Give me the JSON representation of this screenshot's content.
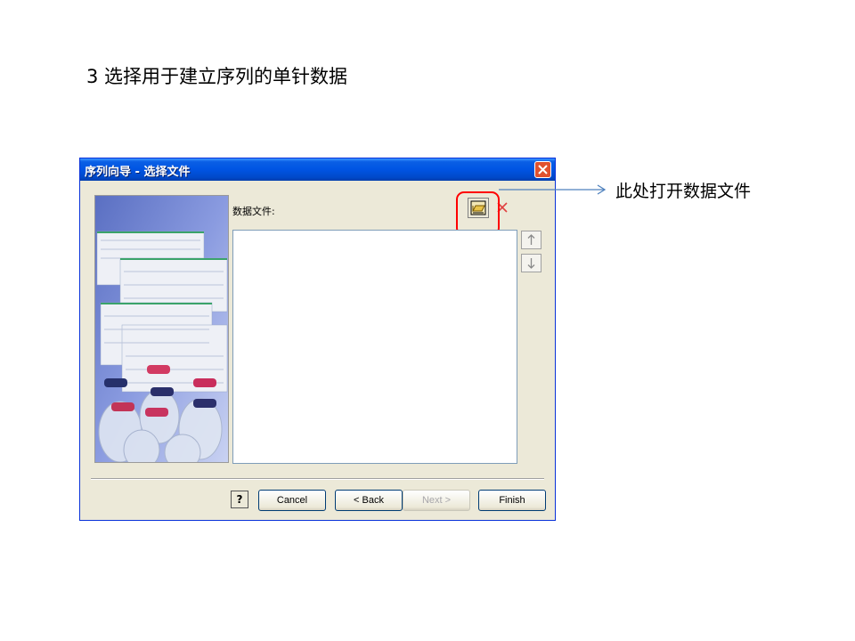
{
  "slide": {
    "title": "3 选择用于建立序列的单针数据",
    "callout": "此处打开数据文件"
  },
  "dialog": {
    "title": "序列向导 - 选择文件",
    "files_label": "数据文件:",
    "buttons": {
      "help": "?",
      "cancel": "Cancel",
      "back": "< Back",
      "next": "Next >",
      "finish": "Finish"
    }
  },
  "colors": {
    "highlight": "#ff0000",
    "callout_line": "#4f81bd",
    "titlebar": "#0054e3"
  },
  "icons": {
    "open": "open-folder-icon",
    "remove": "red-x-icon",
    "move_up": "arrow-up-icon",
    "move_down": "arrow-down-icon",
    "close": "close-icon"
  }
}
